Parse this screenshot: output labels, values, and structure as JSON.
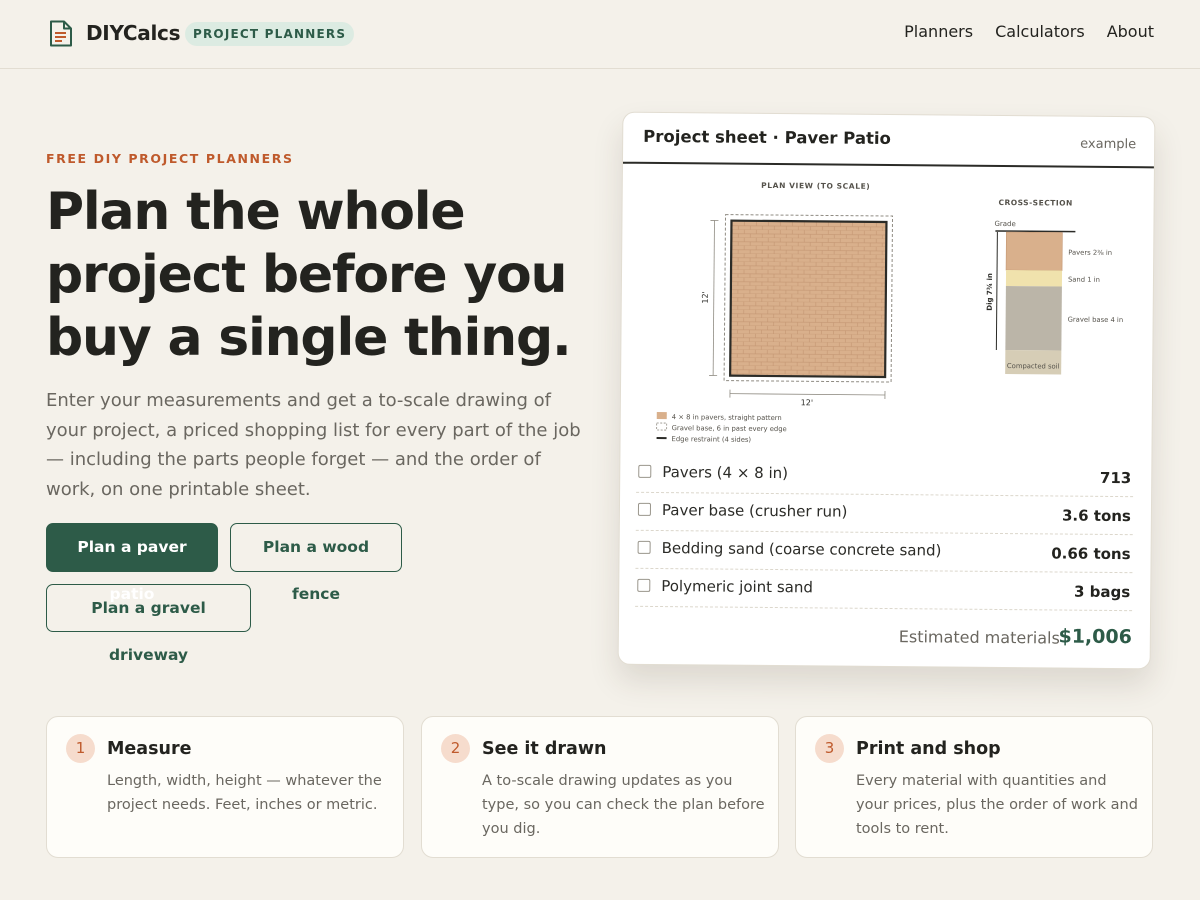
{
  "header": {
    "brand": "DIYCalcs",
    "badge": "PROJECT PLANNERS",
    "nav": [
      "Planners",
      "Calculators",
      "About"
    ]
  },
  "hero": {
    "eyebrow": "FREE DIY PROJECT PLANNERS",
    "title_lines": [
      "Plan the whole",
      "project before you",
      "buy a single thing."
    ],
    "subtitle": "Enter your measurements and get a to-scale drawing of your project, a priced shopping list for every part of the job — including the parts people forget — and the order of work, on one printable sheet.",
    "buttons": {
      "patio": "Plan a paver patio",
      "fence": "Plan a wood fence",
      "driveway": "Plan a gravel driveway"
    }
  },
  "sheet": {
    "title": "Project sheet · Paver Patio",
    "tag": "example",
    "plan_label": "PLAN VIEW (TO SCALE)",
    "plan_width": "12'",
    "plan_length": "12'",
    "legend": [
      "4 × 8 in pavers, straight pattern",
      "Gravel base, 6 in past every edge",
      "Edge restraint (4 sides)"
    ],
    "section_label": "CROSS-SECTION",
    "section_grade": "Grade",
    "section_dig": "Dig 7¾ in",
    "section_layers": [
      "Pavers 2⅜ in",
      "Sand 1 in",
      "Gravel base 4 in",
      "Compacted soil"
    ],
    "materials": [
      {
        "name": "Pavers (4 × 8 in)",
        "qty": "713"
      },
      {
        "name": "Paver base (crusher run)",
        "qty": "3.6 tons"
      },
      {
        "name": "Bedding sand (coarse concrete sand)",
        "qty": "0.66 tons"
      },
      {
        "name": "Polymeric joint sand",
        "qty": "3 bags"
      }
    ],
    "total_label": "Estimated materials",
    "total_value": "$1,006"
  },
  "steps": [
    {
      "num": "1",
      "title": "Measure",
      "text": "Length, width, height — whatever the project needs. Feet, inches or metric."
    },
    {
      "num": "2",
      "title": "See it drawn",
      "text": "A to-scale drawing updates as you type, so you can check the plan before you dig."
    },
    {
      "num": "3",
      "title": "Print and shop",
      "text": "Every material with quantities and your prices, plus the order of work and tools to rent."
    }
  ],
  "colors": {
    "accent": "#2d5b48",
    "orange": "#bf5a2c",
    "paver": "#d9b08c",
    "sand": "#f0e2ad",
    "gravel": "#bbb5a8",
    "soil": "#d6cdb6"
  },
  "icons": {
    "logo": "document-icon"
  }
}
